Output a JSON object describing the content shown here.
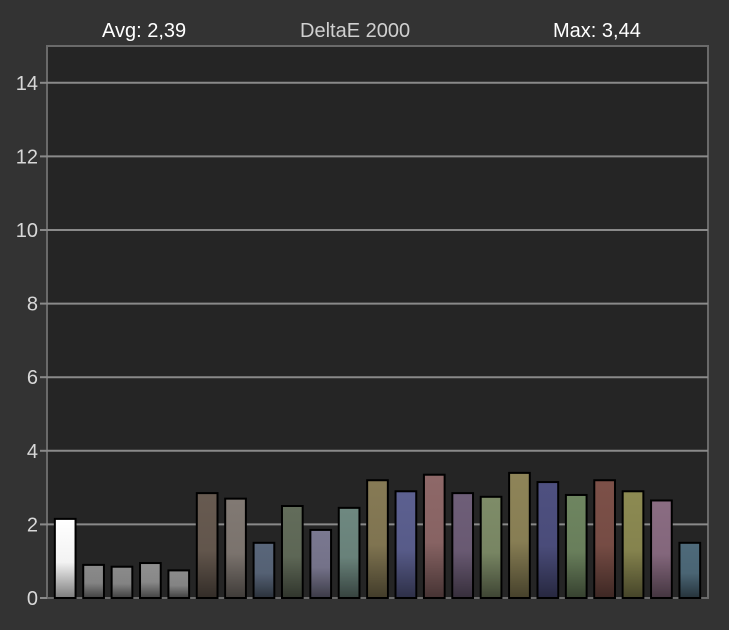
{
  "chart_data": {
    "type": "bar",
    "title": "DeltaE 2000",
    "avg_label": "Avg: 2,39",
    "max_label": "Max: 3,44",
    "xlabel": "",
    "ylabel": "",
    "ylim": [
      0,
      15
    ],
    "yticks": [
      0,
      2,
      4,
      6,
      8,
      10,
      12,
      14
    ],
    "grid": true,
    "values": [
      2.15,
      0.9,
      0.85,
      0.95,
      0.75,
      2.85,
      2.7,
      1.5,
      2.5,
      1.85,
      2.45,
      3.2,
      2.9,
      3.35,
      2.85,
      2.75,
      3.4,
      3.15,
      2.8,
      3.2,
      2.9,
      2.65,
      1.5
    ],
    "bar_colors": [
      "#ffffff",
      "#8a8a8a",
      "#8a8a8a",
      "#8f8f8f",
      "#8a8a8a",
      "#675a50",
      "#817973",
      "#59667a",
      "#626c5a",
      "#7a7890",
      "#6e8880",
      "#867a55",
      "#5c6090",
      "#8e6868",
      "#6e5e78",
      "#7e8c68",
      "#8e8458",
      "#4e5080",
      "#6e8560",
      "#7c5048",
      "#8c8a52",
      "#8a6c82",
      "#4e6a7a"
    ]
  }
}
